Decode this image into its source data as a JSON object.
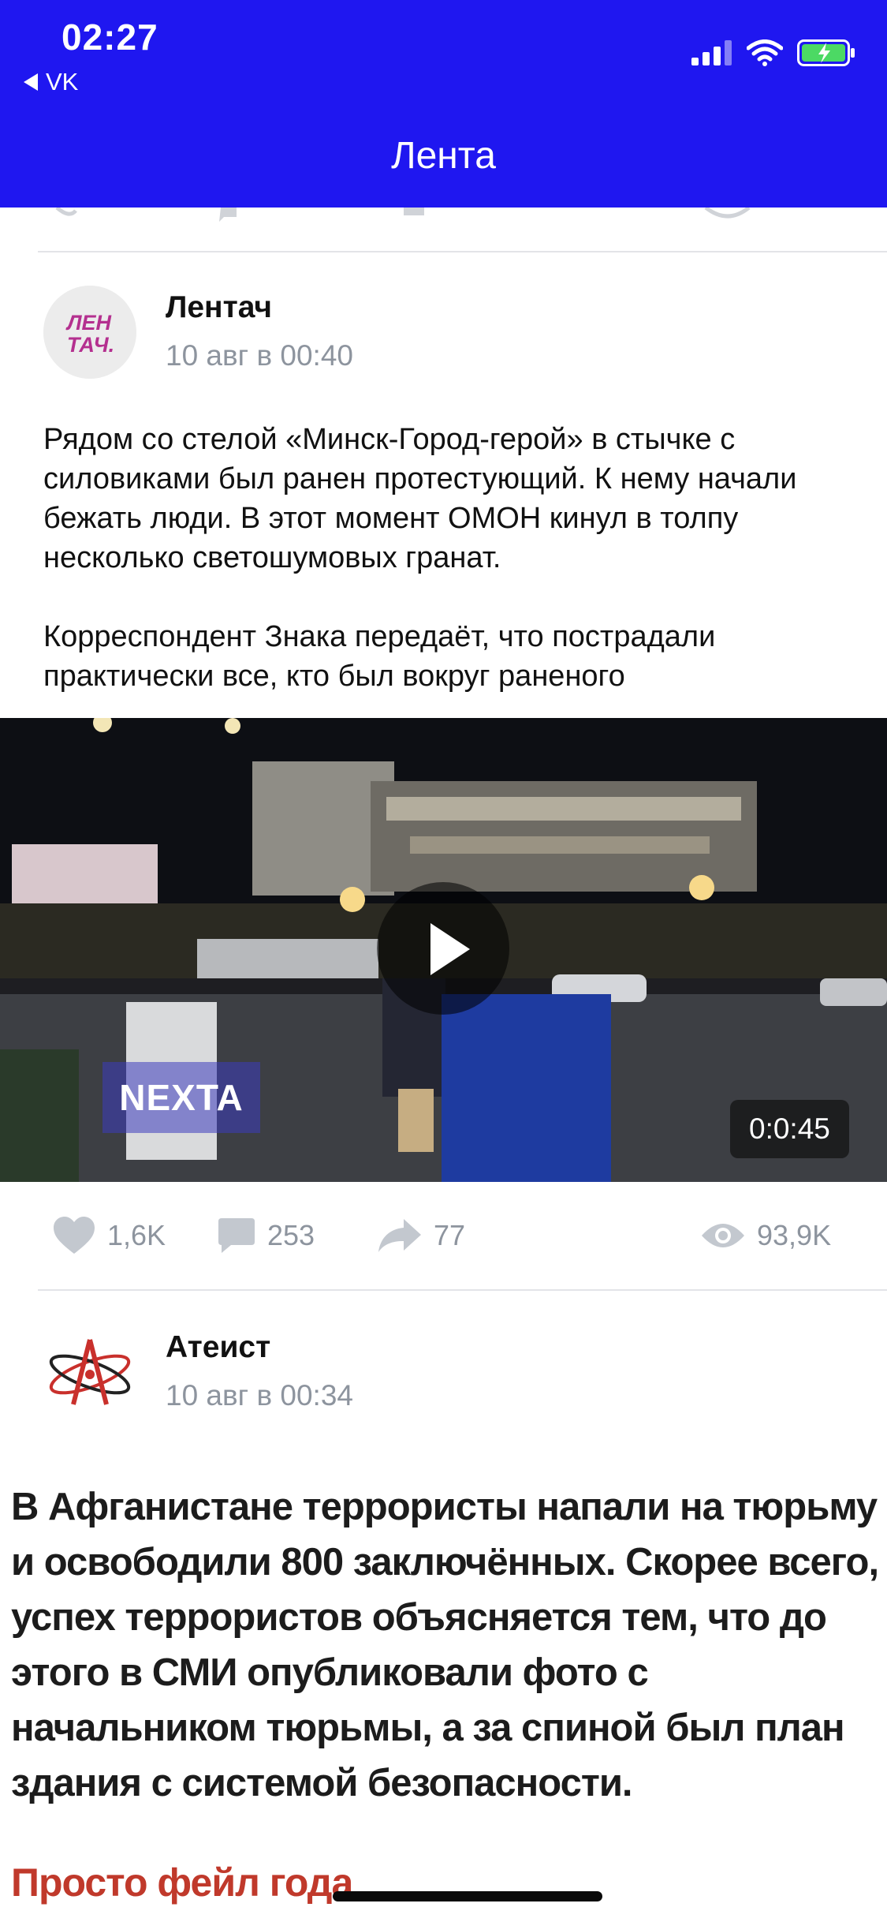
{
  "status_bar": {
    "time": "02:27",
    "back_app": "VK"
  },
  "nav": {
    "title": "Лента"
  },
  "posts": [
    {
      "author": "Лентач",
      "date": "10 авг в 00:40",
      "avatar_text": "ЛЕН ТАЧ.",
      "text_p1": "Рядом со стелой «Минск-Город-герой» в стычке с силовиками был ранен протестующий. К нему начали бежать люди. В этот момент ОМОН кинул в толпу несколько светошумовых гранат.",
      "text_p2": "Корреспондент Знака передаёт, что пострадали практически все, кто был вокруг раненого",
      "video": {
        "duration": "0:0:45",
        "watermark": "NEXTA"
      },
      "likes": "1,6K",
      "comments": "253",
      "reposts": "77",
      "views": "93,9K"
    },
    {
      "author": "Атеист",
      "date": "10 авг в 00:34",
      "image_text": "В Афганистане террористы напали на тюрьму и освободили 800 заключённых. Скорее всего, успех террористов объясняется тем, что до этого в СМИ опубликовали фото с начальником тюрьмы, а за спиной был план здания с системой безопасности.",
      "image_footer": "Просто фейл года"
    }
  ],
  "colors": {
    "header": "#1f17f0",
    "meta": "#8d949e",
    "divider": "#e3e4e8",
    "accent_red": "#c0392b"
  }
}
